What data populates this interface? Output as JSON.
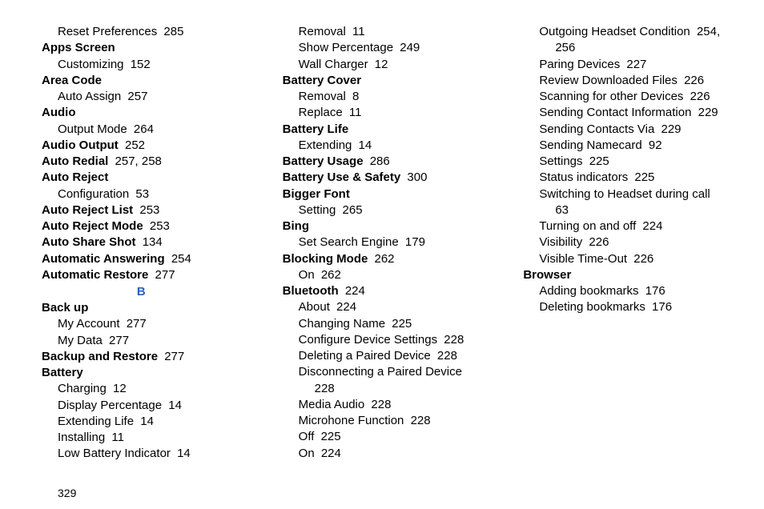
{
  "page_number": "329",
  "section_letter": "B",
  "lines": [
    {
      "type": "sub",
      "text": "Reset Preferences",
      "page": "285"
    },
    {
      "type": "top",
      "text": "Apps Screen"
    },
    {
      "type": "sub",
      "text": "Customizing",
      "page": "152"
    },
    {
      "type": "top",
      "text": "Area Code"
    },
    {
      "type": "sub",
      "text": "Auto Assign",
      "page": "257"
    },
    {
      "type": "top",
      "text": "Audio"
    },
    {
      "type": "sub",
      "text": "Output Mode",
      "page": "264"
    },
    {
      "type": "top",
      "text": "Audio Output",
      "page": "252"
    },
    {
      "type": "top",
      "text": "Auto Redial",
      "page": "257, 258"
    },
    {
      "type": "top",
      "text": "Auto Reject"
    },
    {
      "type": "sub",
      "text": "Configuration",
      "page": "53"
    },
    {
      "type": "top",
      "text": "Auto Reject List",
      "page": "253"
    },
    {
      "type": "top",
      "text": "Auto Reject Mode",
      "page": "253"
    },
    {
      "type": "top",
      "text": "Auto Share Shot",
      "page": "134"
    },
    {
      "type": "top",
      "text": "Automatic Answering",
      "page": "254"
    },
    {
      "type": "top",
      "text": "Automatic Restore",
      "page": "277"
    },
    {
      "type": "letter"
    },
    {
      "type": "top",
      "text": "Back up"
    },
    {
      "type": "sub",
      "text": "My Account",
      "page": "277"
    },
    {
      "type": "sub",
      "text": "My Data",
      "page": "277"
    },
    {
      "type": "top",
      "text": "Backup and Restore",
      "page": "277"
    },
    {
      "type": "top",
      "text": "Battery"
    },
    {
      "type": "sub",
      "text": "Charging",
      "page": "12"
    },
    {
      "type": "sub",
      "text": "Display Percentage",
      "page": "14"
    },
    {
      "type": "sub",
      "text": "Extending Life",
      "page": "14"
    },
    {
      "type": "sub",
      "text": "Installing",
      "page": "11"
    },
    {
      "type": "sub",
      "text": "Low Battery Indicator",
      "page": "14"
    },
    {
      "type": "sub",
      "text": "Removal",
      "page": "11"
    },
    {
      "type": "sub",
      "text": "Show Percentage",
      "page": "249"
    },
    {
      "type": "sub",
      "text": "Wall Charger",
      "page": "12"
    },
    {
      "type": "top",
      "text": "Battery Cover"
    },
    {
      "type": "sub",
      "text": "Removal",
      "page": "8"
    },
    {
      "type": "sub",
      "text": "Replace",
      "page": "11"
    },
    {
      "type": "top",
      "text": "Battery Life"
    },
    {
      "type": "sub",
      "text": "Extending",
      "page": "14"
    },
    {
      "type": "top",
      "text": "Battery Usage",
      "page": "286"
    },
    {
      "type": "top",
      "text": "Battery Use & Safety",
      "page": "300"
    },
    {
      "type": "top",
      "text": "Bigger Font"
    },
    {
      "type": "sub",
      "text": "Setting",
      "page": "265"
    },
    {
      "type": "top",
      "text": "Bing"
    },
    {
      "type": "sub",
      "text": "Set Search Engine",
      "page": "179"
    },
    {
      "type": "top",
      "text": "Blocking Mode",
      "page": "262"
    },
    {
      "type": "sub",
      "text": "On",
      "page": "262"
    },
    {
      "type": "top",
      "text": "Bluetooth",
      "page": "224"
    },
    {
      "type": "sub",
      "text": "About",
      "page": "224"
    },
    {
      "type": "sub",
      "text": "Changing Name",
      "page": "225"
    },
    {
      "type": "sub",
      "text": "Configure Device Settings",
      "page": "228"
    },
    {
      "type": "sub",
      "text": "Deleting a Paired Device",
      "page": "228"
    },
    {
      "type": "sub",
      "text": "Disconnecting a Paired Device",
      "wrap": true
    },
    {
      "type": "sub2",
      "text": "",
      "page": "228",
      "pageonly": true
    },
    {
      "type": "sub",
      "text": "Media Audio",
      "page": "228"
    },
    {
      "type": "sub",
      "text": "Microhone Function",
      "page": "228"
    },
    {
      "type": "sub",
      "text": "Off",
      "page": "225"
    },
    {
      "type": "sub",
      "text": "On",
      "page": "224"
    },
    {
      "type": "sub",
      "text": "Outgoing Headset Condition",
      "page": "254,",
      "wrap": true
    },
    {
      "type": "sub2",
      "text": "",
      "page": "256",
      "pageonly": true
    },
    {
      "type": "sub",
      "text": "Paring Devices",
      "page": "227"
    },
    {
      "type": "sub",
      "text": "Review Downloaded Files",
      "page": "226"
    },
    {
      "type": "sub",
      "text": "Scanning for other Devices",
      "page": "226"
    },
    {
      "type": "sub",
      "text": "Sending Contact Information",
      "page": "229"
    },
    {
      "type": "sub",
      "text": "Sending Contacts Via",
      "page": "229"
    },
    {
      "type": "sub",
      "text": "Sending Namecard",
      "page": "92"
    },
    {
      "type": "sub",
      "text": "Settings",
      "page": "225"
    },
    {
      "type": "sub",
      "text": "Status indicators",
      "page": "225"
    },
    {
      "type": "sub",
      "text": "Switching to Headset during call",
      "wrap": true
    },
    {
      "type": "sub2",
      "text": "",
      "page": "63",
      "pageonly": true
    },
    {
      "type": "sub",
      "text": "Turning on and off",
      "page": "224"
    },
    {
      "type": "sub",
      "text": "Visibility",
      "page": "226"
    },
    {
      "type": "sub",
      "text": "Visible Time-Out",
      "page": "226"
    },
    {
      "type": "top",
      "text": "Browser"
    },
    {
      "type": "sub",
      "text": "Adding bookmarks",
      "page": "176"
    },
    {
      "type": "sub",
      "text": "Deleting bookmarks",
      "page": "176"
    }
  ]
}
